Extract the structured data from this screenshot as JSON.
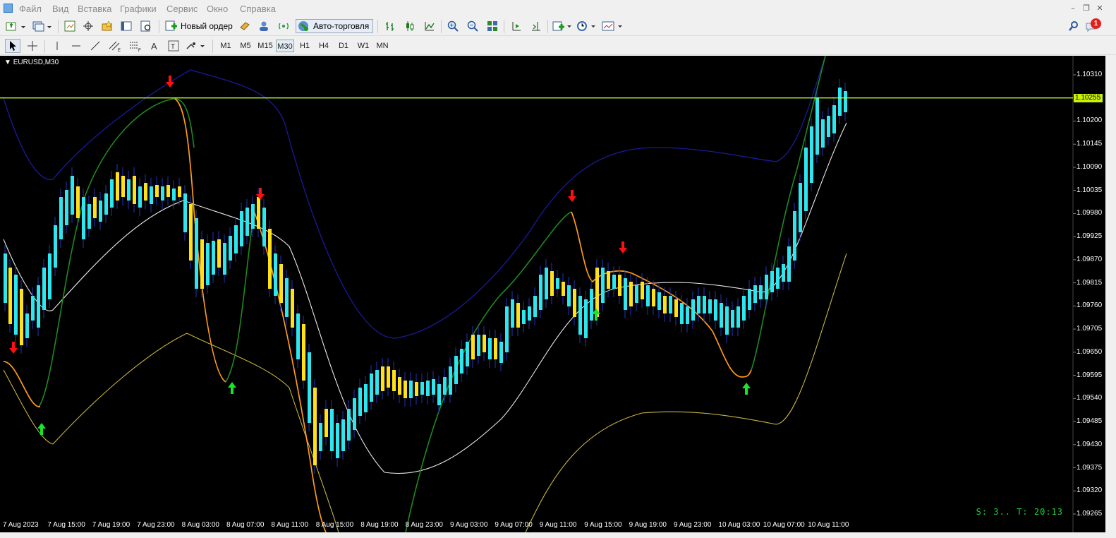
{
  "menu": [
    "Файл",
    "Вид",
    "Вставка",
    "Графики",
    "Сервис",
    "Окно",
    "Справка"
  ],
  "toolbar": {
    "new_order": "Новый ордер",
    "autotrading": "Авто-торговля",
    "alert_badge": "1"
  },
  "timeframes": [
    "M1",
    "M5",
    "M15",
    "M30",
    "H1",
    "H4",
    "D1",
    "W1",
    "MN"
  ],
  "active_timeframe": "M30",
  "chart": {
    "symbol_label": "EURUSD,M30",
    "current_price": "1.10255",
    "status_text": "S: 3.. T: 20:13",
    "price_axis": [
      "1.10310",
      "1.10200",
      "1.10145",
      "1.10090",
      "1.10035",
      "1.09980",
      "1.09925",
      "1.09870",
      "1.09815",
      "1.09760",
      "1.09705",
      "1.09650",
      "1.09595",
      "1.09540",
      "1.09485",
      "1.09430",
      "1.09375",
      "1.09320",
      "1.09265"
    ],
    "time_axis": [
      "7 Aug 2023",
      "7 Aug 15:00",
      "7 Aug 19:00",
      "7 Aug 23:00",
      "8 Aug 03:00",
      "8 Aug 07:00",
      "8 Aug 11:00",
      "8 Aug 15:00",
      "8 Aug 19:00",
      "8 Aug 23:00",
      "9 Aug 03:00",
      "9 Aug 07:00",
      "9 Aug 11:00",
      "9 Aug 15:00",
      "9 Aug 19:00",
      "9 Aug 23:00",
      "10 Aug 03:00",
      "10 Aug 07:00",
      "10 Aug 11:00"
    ],
    "colors": {
      "background": "#000000",
      "bull": "#2ee6f0",
      "bear": "#ffe11a",
      "price_line": "#b8ff2a",
      "band_outer": "#1a1a9a",
      "band_mid": "#e8e8e8",
      "band_low": "#c8b440",
      "trend_green": "#1f8a1f",
      "trend_orange": "#ff9a1a",
      "arrow_down": "#ff1010",
      "arrow_up": "#19e62a"
    }
  }
}
